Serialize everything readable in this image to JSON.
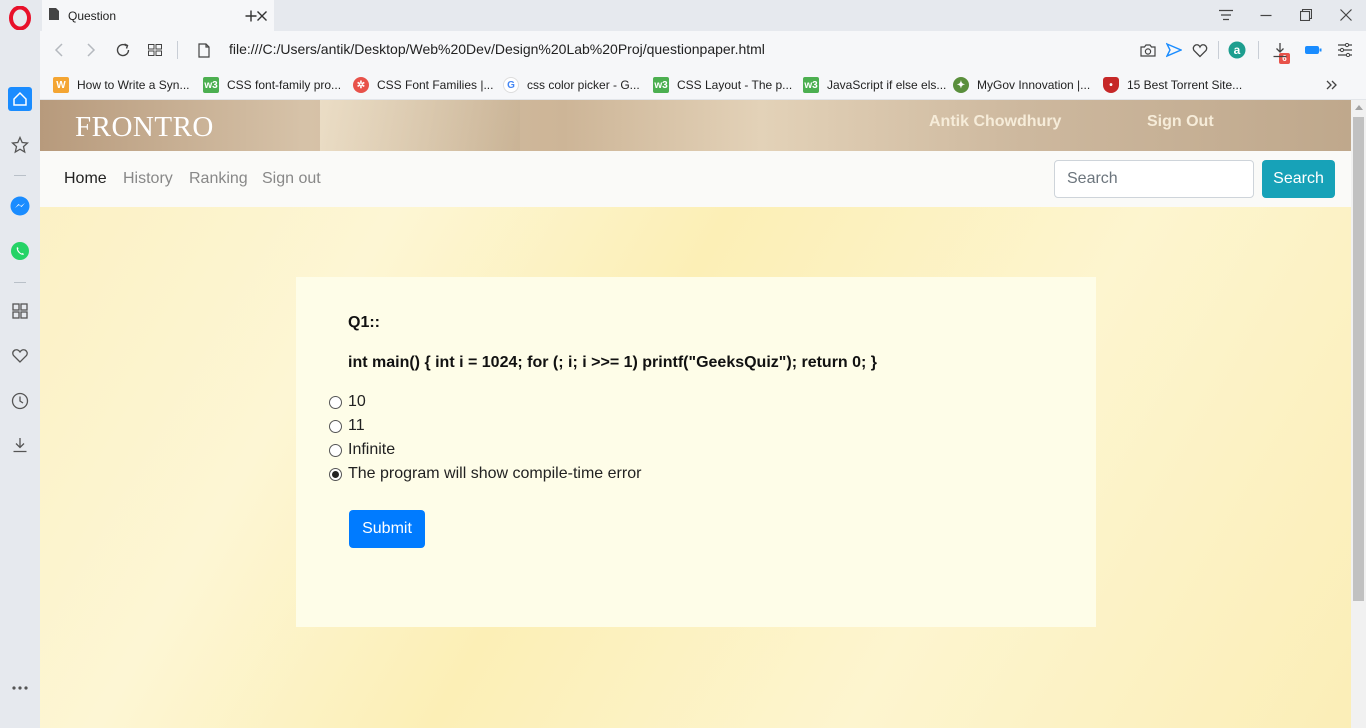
{
  "browser": {
    "tab_title": "Question",
    "url": "file:///C:/Users/antik/Desktop/Web%20Dev/Design%20Lab%20Proj/questionpaper.html",
    "extension_badge": "6",
    "bookmarks": [
      {
        "label": "How to Write a Syn...",
        "icon": "w-icon",
        "color": "#f4a532"
      },
      {
        "label": "CSS font-family pro...",
        "icon": "w3schools-icon",
        "color": "#4caf50"
      },
      {
        "label": "CSS Font Families |...",
        "icon": "flower-icon",
        "color": "#e8524a"
      },
      {
        "label": "css color picker - G...",
        "icon": "google-icon",
        "color": "#4285f4"
      },
      {
        "label": "CSS Layout - The p...",
        "icon": "w3schools-icon",
        "color": "#4caf50"
      },
      {
        "label": "JavaScript if else els...",
        "icon": "w3schools-icon",
        "color": "#4caf50"
      },
      {
        "label": "MyGov Innovation |...",
        "icon": "mygov-icon",
        "color": "#5a8f3c"
      },
      {
        "label": "15 Best Torrent Site...",
        "icon": "shield-icon",
        "color": "#c62828"
      }
    ]
  },
  "site": {
    "brand": "FRONTRO",
    "user_name": "Antik Chowdhury",
    "sign_out_top": "Sign Out",
    "nav": [
      "Home",
      "History",
      "Ranking",
      "Sign out"
    ],
    "search_placeholder": "Search",
    "search_button": "Search"
  },
  "question": {
    "number": "Q1::",
    "text": "int main() { int i = 1024; for (; i; i >>= 1) printf(\"GeeksQuiz\"); return 0; }",
    "options": [
      "10",
      "11",
      "Infinite",
      "The program will show compile-time error"
    ],
    "selected_index": 3,
    "submit_label": "Submit"
  },
  "colors": {
    "search_button": "#17a2b8",
    "submit_button": "#007bff",
    "opera_red": "#e8102a",
    "accent_blue": "#1a8cff"
  }
}
